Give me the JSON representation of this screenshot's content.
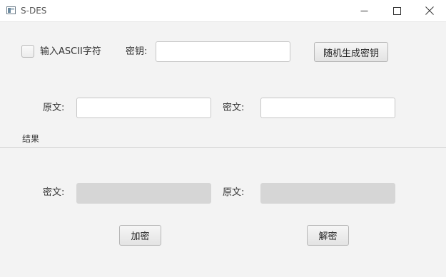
{
  "window": {
    "title": "S-DES",
    "icon": "app-window-icon",
    "controls": [
      "minimize-icon",
      "maximize-icon",
      "close-icon"
    ]
  },
  "options": {
    "ascii_checkbox_label": "输入ASCII字符",
    "ascii_checked": false
  },
  "key": {
    "label": "密钥:",
    "value": "",
    "generate_button": "随机生成密钥"
  },
  "input": {
    "plaintext_label": "原文:",
    "plaintext_value": "",
    "ciphertext_label": "密文:",
    "ciphertext_value": ""
  },
  "result": {
    "section_title": "结果",
    "ciphertext_label": "密文:",
    "ciphertext_value": "",
    "plaintext_label": "原文:",
    "plaintext_value": ""
  },
  "actions": {
    "encrypt": "加密",
    "decrypt": "解密"
  }
}
